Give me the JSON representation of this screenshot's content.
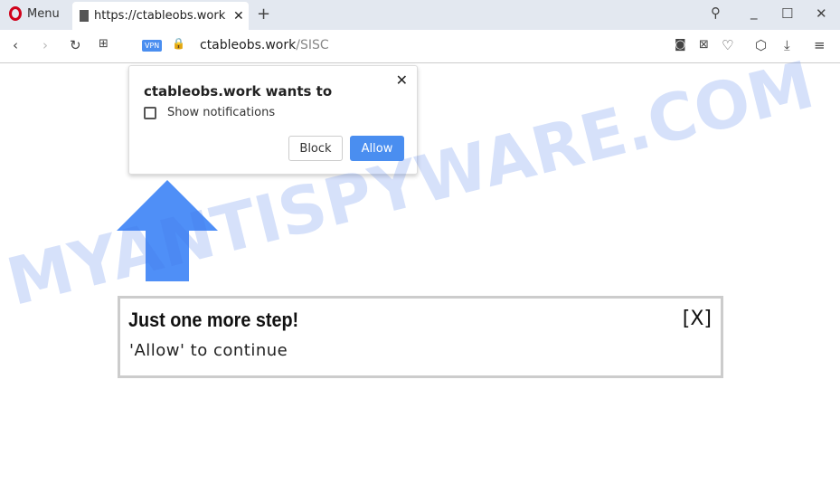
{
  "browser": {
    "menu_label": "Menu",
    "tab_title": "https://ctableobs.work",
    "vpn_label": "VPN",
    "url_host": "ctableobs.work",
    "url_path": "/SISC"
  },
  "permission_popup": {
    "title": "ctableobs.work wants to",
    "permission": "Show notifications",
    "block_label": "Block",
    "allow_label": "Allow"
  },
  "page": {
    "heading": "Just one more step!",
    "message": "'Allow' to continue",
    "close_label": "[X]",
    "watermark": "MYANTISPYWARE.COM"
  },
  "colors": {
    "accent": "#4a8ef0",
    "arrow": "#4f8ff7"
  }
}
